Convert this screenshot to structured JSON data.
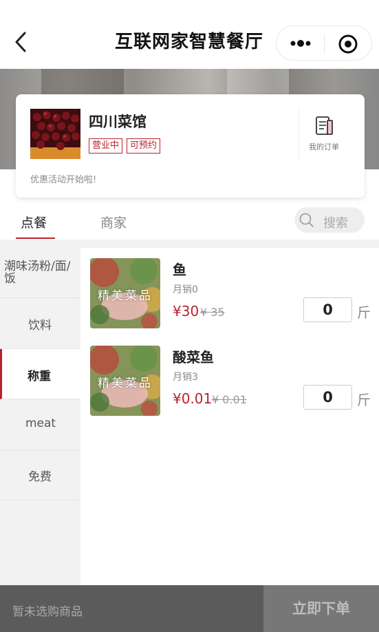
{
  "header": {
    "title": "互联网家智慧餐厅",
    "back_icon": "chevron-left-icon",
    "more_icon": "more-dots-icon",
    "close_icon": "target-icon"
  },
  "shop": {
    "name": "四川菜馆",
    "badges": [
      "营业中",
      "可预约"
    ],
    "orders_label": "我的订单",
    "promo": "优惠活动开始啦!",
    "accent_color": "#b6242d"
  },
  "tabs": {
    "order": "点餐",
    "merchant": "商家",
    "search_placeholder": "搜索"
  },
  "categories": [
    {
      "label": "潮味汤粉/面/饭",
      "active": false
    },
    {
      "label": "饮料",
      "active": false
    },
    {
      "label": "称重",
      "active": true
    },
    {
      "label": "meat",
      "active": false
    },
    {
      "label": "免费",
      "active": false
    }
  ],
  "products": [
    {
      "image_text": "精美菜品",
      "name": "鱼",
      "sales": "月销0",
      "price": "¥30",
      "original_price": "¥ 35",
      "quantity": "0",
      "unit": "斤"
    },
    {
      "image_text": "精美菜品",
      "name": "酸菜鱼",
      "sales": "月销3",
      "price": "¥0.01",
      "original_price": "¥ 0.01",
      "quantity": "0",
      "unit": "斤"
    }
  ],
  "cart": {
    "empty_text": "暂未选购商品",
    "submit_label": "立即下单"
  }
}
